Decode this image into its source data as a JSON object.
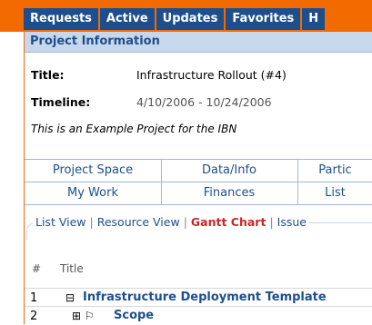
{
  "top_tabs": [
    "Requests",
    "Active",
    "Updates",
    "Favorites",
    "H"
  ],
  "panel": {
    "title": "Project Information"
  },
  "project": {
    "title_label": "Title:",
    "title_value": "Infrastructure Rollout (#4)",
    "timeline_label": "Timeline:",
    "timeline_value": "4/10/2006 - 10/24/2006",
    "description": "This is an Example Project for the IBN"
  },
  "nav": {
    "row1": [
      "Project Space",
      "Data/Info",
      "Partic"
    ],
    "row2": [
      "My Work",
      "Finances",
      "List"
    ]
  },
  "views": {
    "links": [
      "List View",
      "Resource View",
      "Gantt Chart",
      "Issue"
    ],
    "active": "Gantt Chart"
  },
  "table": {
    "headers": {
      "num": "#",
      "title": "Title"
    },
    "rows": [
      {
        "num": "1",
        "expander": "⊟",
        "name": "Infrastructure Deployment Template"
      },
      {
        "num": "2",
        "expander": "⊞ ⚐",
        "name": "Scope"
      }
    ]
  }
}
